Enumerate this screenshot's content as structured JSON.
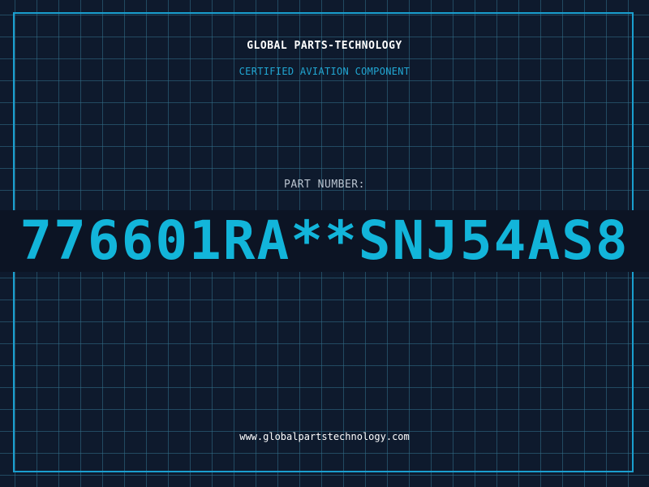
{
  "brand": {
    "name": "GLOBAL PARTS-TECHNOLOGY",
    "tagline": "CERTIFIED AVIATION COMPONENT"
  },
  "part": {
    "label": "PART NUMBER:",
    "number": "776601RA**SNJ54AS8"
  },
  "footer": {
    "url": "www.globalpartstechnology.com"
  },
  "colors": {
    "background": "#0e1a2d",
    "grid": "#34708c",
    "frame": "#1a9fcf",
    "accent": "#12b5da",
    "band": "#0c1424"
  }
}
